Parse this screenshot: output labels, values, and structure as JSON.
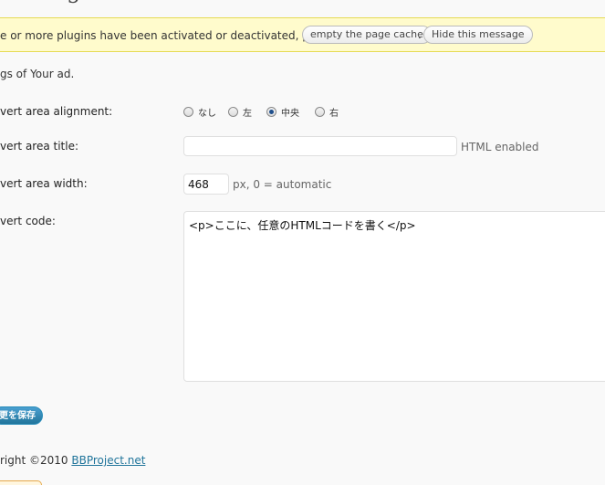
{
  "notice": {
    "message": "e or more plugins have been activated or deactivated, please",
    "separator": ".",
    "empty_cache_label": "empty the page cache",
    "hide_label": "Hide this message"
  },
  "intro": "gs of Your ad.",
  "fields": {
    "alignment_label": "vert area alignment:",
    "alignment_options": [
      {
        "label": "なし",
        "checked": false
      },
      {
        "label": "左",
        "checked": false
      },
      {
        "label": "中央",
        "checked": true
      },
      {
        "label": "右",
        "checked": false
      }
    ],
    "title_label": "vert area title:",
    "title_value": "",
    "title_hint": "HTML enabled",
    "width_label": "vert area width:",
    "width_value": "468",
    "width_hint": "px, 0 = automatic",
    "code_label": "vert code:",
    "code_value": "<p>ここに、任意のHTMLコードを書く</p>"
  },
  "save_label": "更を保存",
  "footer": {
    "text": "right ©2010 ",
    "link": "BBProject.net"
  }
}
